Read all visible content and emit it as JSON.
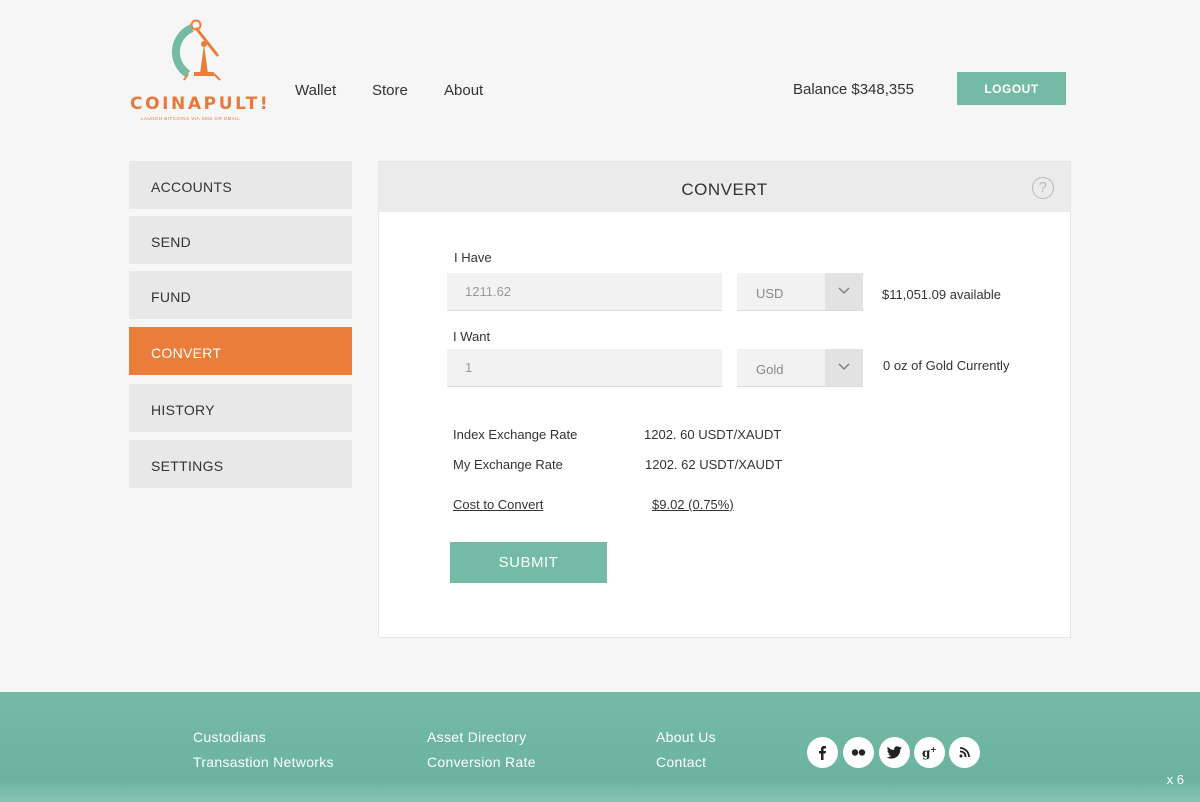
{
  "brand": {
    "name": "COINAPULT!",
    "tagline": "LAUNCH BITCOINS VIA SMS OR EMAIL"
  },
  "nav": {
    "items": [
      "Wallet",
      "Store",
      "About"
    ]
  },
  "header": {
    "balance": "Balance $348,355",
    "logout_label": "LOGOUT"
  },
  "sidebar": {
    "items": [
      {
        "label": "ACCOUNTS"
      },
      {
        "label": "SEND"
      },
      {
        "label": "FUND"
      },
      {
        "label": "CONVERT",
        "active": true
      },
      {
        "label": "HISTORY"
      },
      {
        "label": "SETTINGS"
      }
    ]
  },
  "convert": {
    "title": "CONVERT",
    "help_icon": "question-circle-icon",
    "have_label": "I Have",
    "have_value": "1211.62",
    "have_currency": "USD",
    "have_note": "$11,051.09 available",
    "want_label": "I Want",
    "want_value": "1",
    "want_currency": "Gold",
    "want_note": "0 oz of Gold Currently",
    "index_rate_label": "Index Exchange Rate",
    "index_rate_value": "1202. 60  USDT/XAUDT",
    "my_rate_label": "My Exchange Rate",
    "my_rate_value": "1202. 62  USDT/XAUDT",
    "cost_label": "Cost to Convert",
    "cost_value": "$9.02 (0.75%)",
    "submit_label": "SUBMIT"
  },
  "footer": {
    "col1": [
      "Custodians",
      "Transastion Networks"
    ],
    "col2": [
      "Asset Directory",
      "Conversion Rate"
    ],
    "col3": [
      "About Us",
      "Contact"
    ],
    "social_icons": [
      "facebook-icon",
      "flickr-icon",
      "twitter-icon",
      "google-plus-icon",
      "rss-icon"
    ],
    "zoom": "x 6"
  },
  "colors": {
    "accent_orange": "#e97e3b",
    "teal": "#74bba6",
    "sidebar_bg": "#e8e8e8"
  }
}
